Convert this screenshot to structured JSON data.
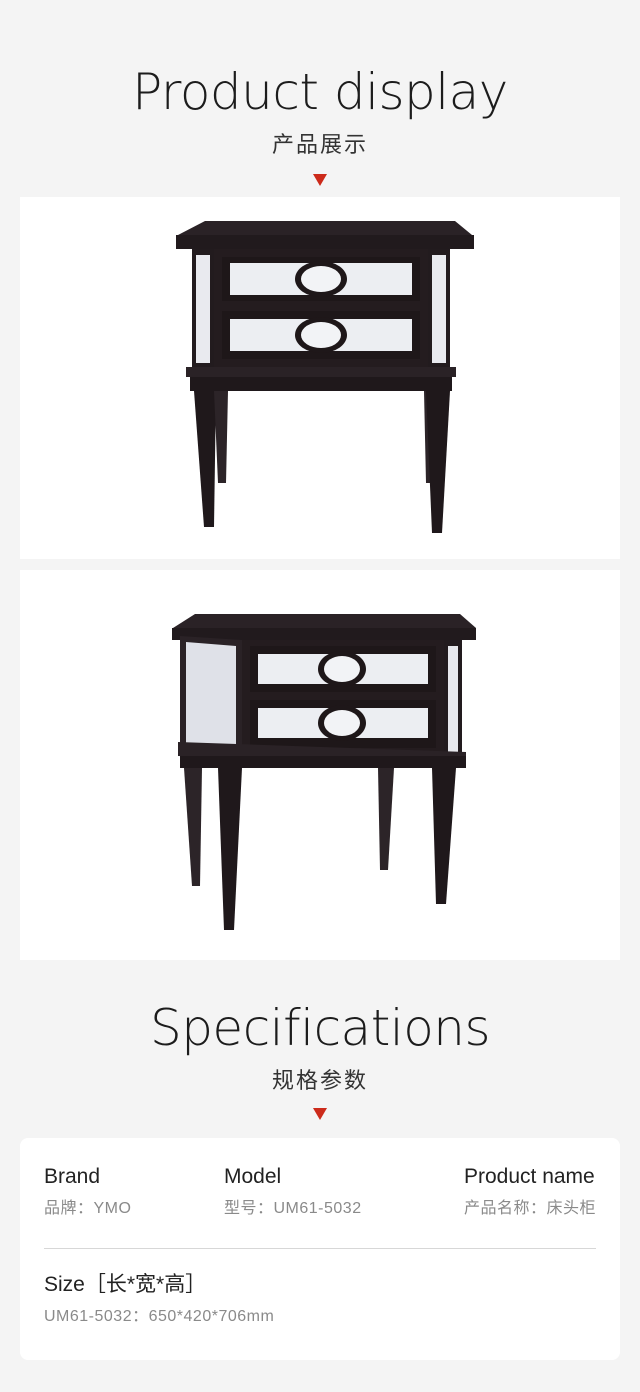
{
  "display": {
    "title_en": "Product display",
    "title_cn": "产品展示"
  },
  "specifications": {
    "title_en": "Specifications",
    "title_cn": "规格参数",
    "brand": {
      "label": "Brand",
      "value": "品牌：YMO"
    },
    "model": {
      "label": "Model",
      "value": "型号：UM61-5032"
    },
    "product_name": {
      "label": "Product name",
      "value": "产品名称：床头柜"
    },
    "size": {
      "label": "Size［长*宽*高］",
      "value": "UM61-5032：650*420*706mm"
    }
  },
  "colors": {
    "accent": "#cc2a1a",
    "background": "#f4f4f4",
    "wood": "#241c1e",
    "mirror": "#e8e9ee"
  },
  "icons": [
    "down-triangle-icon"
  ]
}
